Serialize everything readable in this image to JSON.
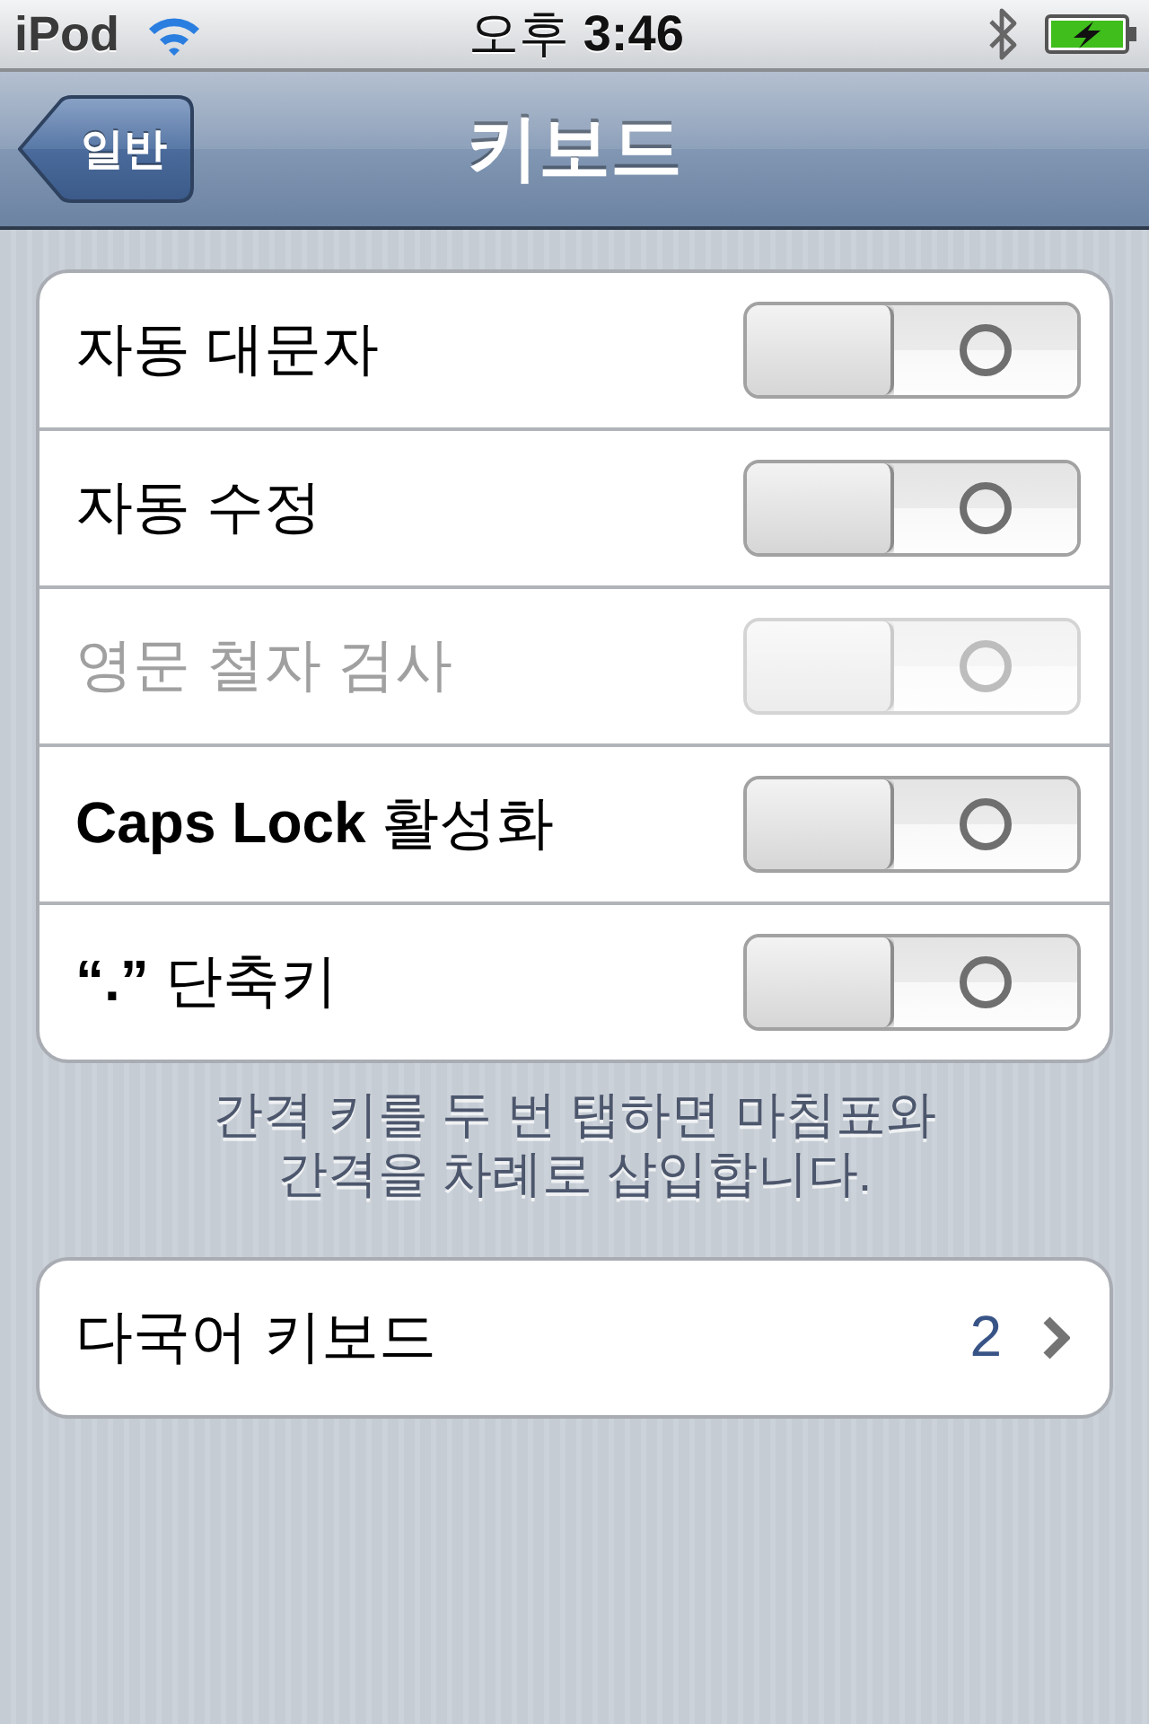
{
  "status_bar": {
    "carrier": "iPod",
    "time": "오후 **3:46**"
  },
  "nav_bar": {
    "back_button": "일반",
    "title": "키보드"
  },
  "settings": [
    {
      "label": "자동 대문자",
      "on": false,
      "disabled": false
    },
    {
      "label": "자동 수정",
      "on": false,
      "disabled": false
    },
    {
      "label": "영문 철자 검사",
      "on": false,
      "disabled": true
    },
    {
      "label": "**Caps Lock** 활성화",
      "on": false,
      "disabled": false
    },
    {
      "label": "**“.”** 단축키",
      "on": false,
      "disabled": false
    }
  ],
  "settings_footer": "간격 키를 두 번 탭하면 마침표와 간격을 차례로 삽입합니다.",
  "keyboards_row": {
    "label": "다국어 키보드",
    "value": "2"
  }
}
